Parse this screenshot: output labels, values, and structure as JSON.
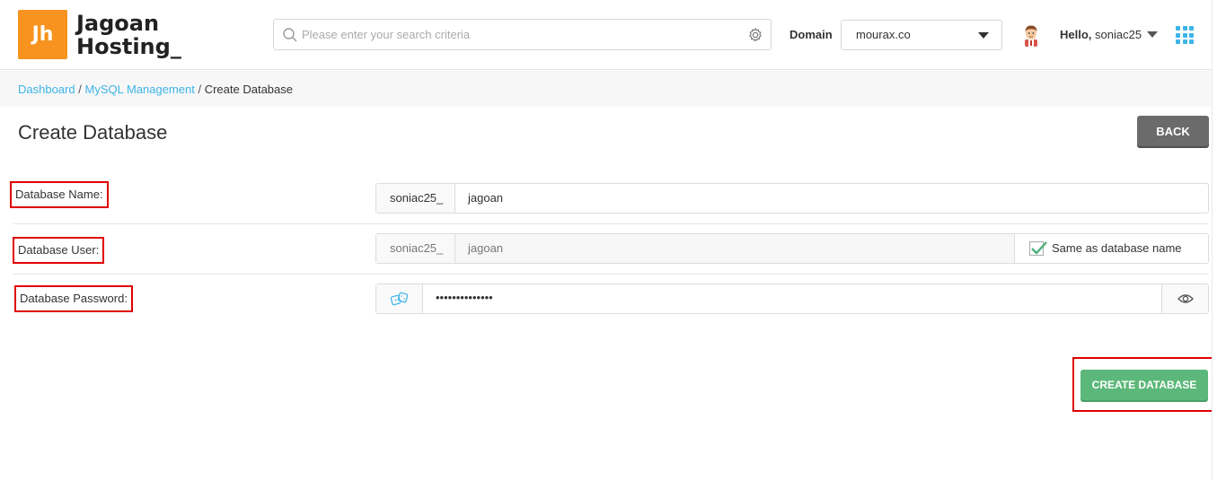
{
  "header": {
    "logo_mark": "Jh",
    "logo_line1": "Jagoan",
    "logo_line2": "Hosting_",
    "search_placeholder": "Please enter your search criteria",
    "domain_label": "Domain",
    "domain_value": "mourax.co",
    "hello_prefix": "Hello,",
    "username": "soniac25"
  },
  "breadcrumb": {
    "items": [
      "Dashboard",
      "MySQL Management"
    ],
    "separator": "/",
    "current": "Create Database"
  },
  "page": {
    "title": "Create Database",
    "back_label": "BACK"
  },
  "form": {
    "db_name_label": "Database Name:",
    "db_name_prefix": "soniac25_",
    "db_name_value": "jagoan",
    "db_user_label": "Database User:",
    "db_user_prefix": "soniac25_",
    "db_user_value": "jagoan",
    "same_as_label": "Same as database name",
    "same_as_checked": true,
    "db_password_label": "Database Password:",
    "db_password_masked": "••••••••••••••",
    "submit_label": "CREATE DATABASE"
  },
  "colors": {
    "accent_blue": "#3db4e8",
    "brand_orange": "#f7931e",
    "submit_green": "#5cb87a",
    "back_gray": "#6b6b6b",
    "highlight_red": "#e00000"
  }
}
